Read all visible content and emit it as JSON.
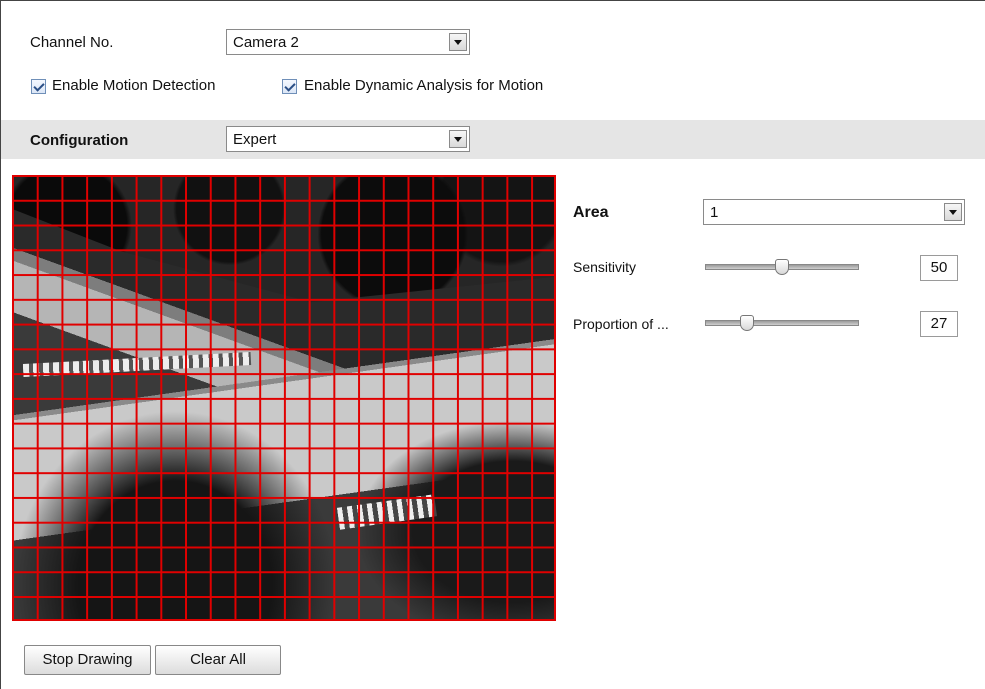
{
  "channel": {
    "label": "Channel No.",
    "value": "Camera 2"
  },
  "options": {
    "enable_motion_detection": {
      "label": "Enable Motion Detection",
      "checked": true
    },
    "enable_dynamic_analysis": {
      "label": "Enable Dynamic Analysis for Motion",
      "checked": true
    }
  },
  "configuration": {
    "label": "Configuration",
    "value": "Expert"
  },
  "area": {
    "label": "Area",
    "value": "1"
  },
  "sensitivity": {
    "label": "Sensitivity",
    "value": "50",
    "level": 50
  },
  "proportion": {
    "label": "Proportion of ...",
    "value": "27",
    "level": 27
  },
  "grid_color": "#e00000",
  "buttons": {
    "stop_drawing": "Stop Drawing",
    "clear_all": "Clear All"
  }
}
